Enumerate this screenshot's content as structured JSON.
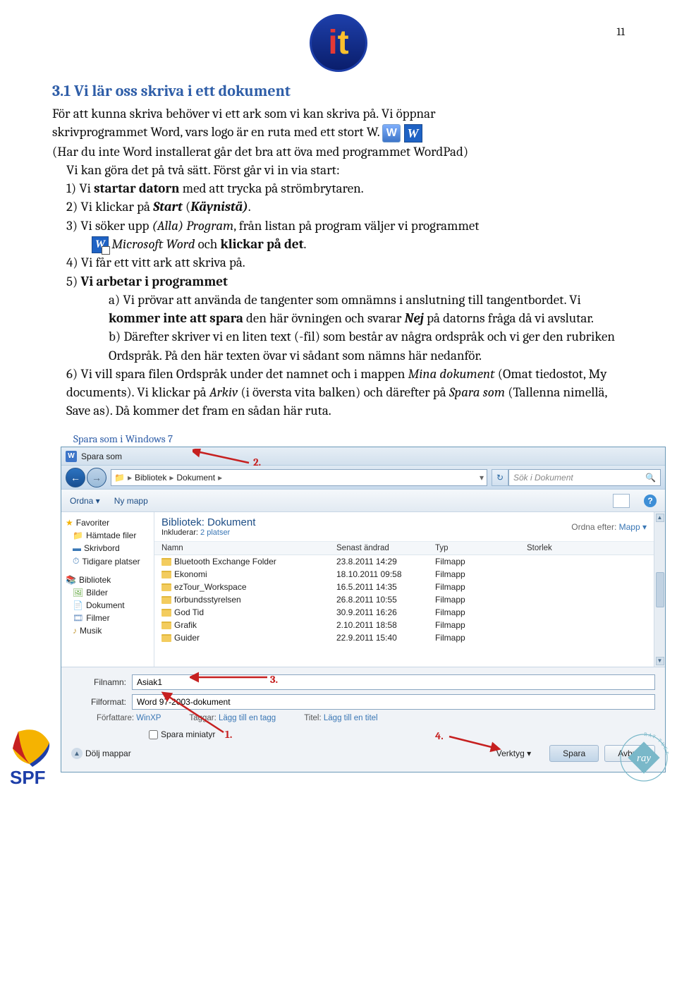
{
  "page_number": "11",
  "heading": "3.1 Vi lär oss skriva i ett dokument",
  "p1a": "För att kunna skriva behöver vi ett ark som vi kan skriva på. Vi öppnar",
  "p1b": "skrivprogrammet Word, vars logo är en ruta med ett stort W.  ",
  "p2": "(Har du inte Word installerat går det bra att öva med programmet WordPad)",
  "li_pre": "Vi kan göra det på två sätt. Först går vi in via start:",
  "li1a": "1) Vi ",
  "li1b": "startar datorn",
  "li1c": " med att trycka på strömbrytaren.",
  "li2a": "2) Vi klickar på ",
  "li2b": "Start",
  "li2c": " (",
  "li2d": "Käynistä)",
  "li2e": ".",
  "li3a": "3) Vi söker upp ",
  "li3b": "(Alla) Program",
  "li3c": ", från listan på program väljer vi programmet",
  "li3d": "Microsoft Word",
  "li3e": " och ",
  "li3f": "klickar på det",
  "li3g": ".",
  "li4": "4) Vi får ett vitt ark att skriva på.",
  "li5a": "5) ",
  "li5b": "Vi arbetar i programmet",
  "li5_a1": "a) Vi prövar att använda de tangenter som omnämns i anslutning till tangentbordet. Vi ",
  "li5_a2": "kommer inte att spara",
  "li5_a3": " den här övningen och svarar ",
  "li5_a4": "Nej",
  "li5_a5": " på datorns fråga då vi avslutar.",
  "li5_b": "b) Därefter skriver vi en liten text (-fil) som består av några ordspråk och vi ger den rubriken Ordspråk. På den här texten övar vi sådant som nämns här nedanför.",
  "li6a": "6) Vi vill spara filen Ordspråk under det namnet och i mappen ",
  "li6b": "Mina dokument",
  "li6c": " (Omat tiedostot, My documents). Vi klickar på ",
  "li6d": "Arkiv",
  "li6e": " (i översta vita balken) och därefter på ",
  "li6f": "Spara som",
  "li6g": " (Tallenna nimellä, Save as). Då kommer det fram en sådan här ruta.",
  "caption": "Spara som i Windows 7",
  "dlg": {
    "title": "Spara som",
    "crumb1": "Bibliotek",
    "crumb2": "Dokument",
    "search_ph": "Sök i Dokument",
    "ordna": "Ordna ▾",
    "ny_mapp": "Ny mapp",
    "bib_head": "Bibliotek: Dokument",
    "bib_sub1": "Inkluderar:  ",
    "bib_sub2": "2 platser",
    "sort_label": "Ordna efter:",
    "sort_val": "Mapp ▾",
    "cols": {
      "name": "Namn",
      "date": "Senast ändrad",
      "type": "Typ",
      "size": "Storlek"
    },
    "rows": [
      {
        "n": "Bluetooth Exchange Folder",
        "d": "23.8.2011 14:29",
        "t": "Filmapp"
      },
      {
        "n": "Ekonomi",
        "d": "18.10.2011 09:58",
        "t": "Filmapp"
      },
      {
        "n": "ezTour_Workspace",
        "d": "16.5.2011 14:35",
        "t": "Filmapp"
      },
      {
        "n": "förbundsstyrelsen",
        "d": "26.8.2011 10:55",
        "t": "Filmapp"
      },
      {
        "n": "God Tid",
        "d": "30.9.2011 16:26",
        "t": "Filmapp"
      },
      {
        "n": "Grafik",
        "d": "2.10.2011 18:58",
        "t": "Filmapp"
      },
      {
        "n": "Guider",
        "d": "22.9.2011 15:40",
        "t": "Filmapp"
      }
    ],
    "sidebar": {
      "fav": "Favoriter",
      "dl": "Hämtade filer",
      "desk": "Skrivbord",
      "recent": "Tidigare platser",
      "bib": "Bibliotek",
      "pic": "Bilder",
      "doc": "Dokument",
      "film": "Filmer",
      "mus": "Musik"
    },
    "filn_label": "Filnamn:",
    "filn_val": "Asiak1",
    "filf_label": "Filformat:",
    "filf_val": "Word 97-2003-dokument",
    "auth_label": "Författare:",
    "auth_val": "WinXP",
    "tag_label": "Taggar:",
    "tag_val": "Lägg till en tagg",
    "title_label": "Titel:",
    "title_val": "Lägg till en titel",
    "mini": "Spara miniatyr",
    "hide": "Dölj mappar",
    "verk": "Verktyg  ▾",
    "save": "Spara",
    "cancel": "Avbryt"
  },
  "ann": {
    "n1": "1.",
    "n2": "2.",
    "n3": "3.",
    "n4": "4."
  },
  "spf": "SPF"
}
